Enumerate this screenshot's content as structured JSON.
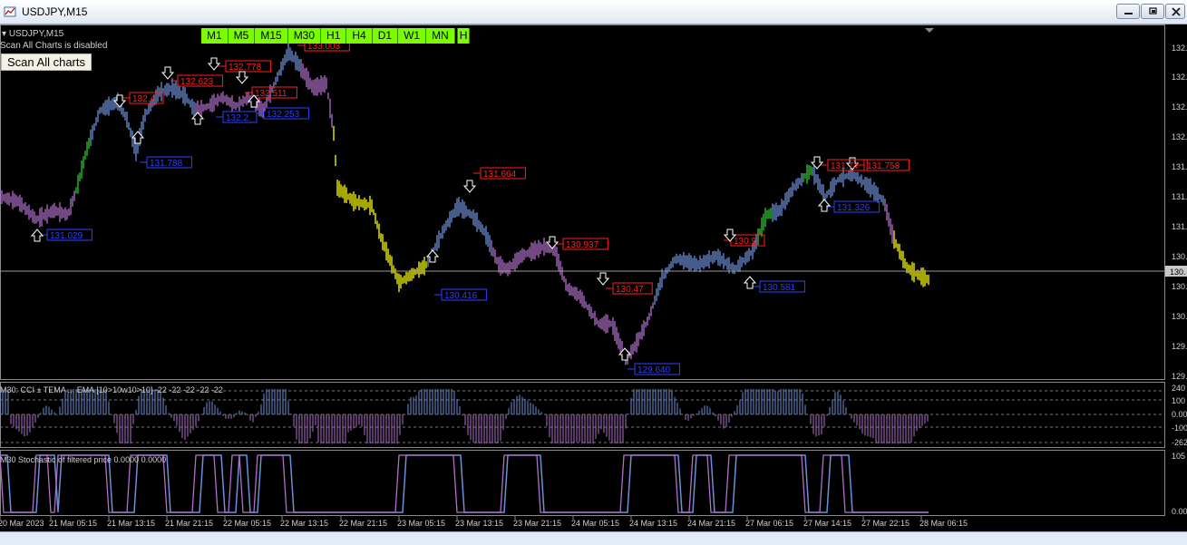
{
  "window": {
    "title": "USDJPY,M15",
    "controls": [
      "minimize",
      "restore",
      "close"
    ]
  },
  "chart": {
    "symbol_label": "USDJPY,M15",
    "status_text": "Scan All Charts is disabled",
    "scan_button": "Scan All charts",
    "timeframes": [
      "M1",
      "M5",
      "M15",
      "M30",
      "H1",
      "H4",
      "D1",
      "W1",
      "MN"
    ],
    "extra_button": "H",
    "price_axis": [
      "132.",
      "132.",
      "132.",
      "132.",
      "131.",
      "131.",
      "131.",
      "130.",
      "130.",
      "130.",
      "129.",
      "129."
    ],
    "current_price_tag": "130.",
    "sr_labels": [
      {
        "text": "133.003",
        "color": "red"
      },
      {
        "text": "132.778",
        "color": "red"
      },
      {
        "text": "132.623",
        "color": "red"
      },
      {
        "text": "132.511",
        "color": "red"
      },
      {
        "text": "132.4",
        "color": "red"
      },
      {
        "text": "132.253",
        "color": "blue"
      },
      {
        "text": "132.2",
        "color": "blue"
      },
      {
        "text": "131.788",
        "color": "blue"
      },
      {
        "text": "131.029",
        "color": "blue"
      },
      {
        "text": "131.664",
        "color": "red"
      },
      {
        "text": "130.937",
        "color": "red"
      },
      {
        "text": "130.416",
        "color": "blue"
      },
      {
        "text": "130.47",
        "color": "red"
      },
      {
        "text": "129.640",
        "color": "blue"
      },
      {
        "text": "131.758",
        "color": "red"
      },
      {
        "text": "131.74",
        "color": "red"
      },
      {
        "text": "131.326",
        "color": "blue"
      },
      {
        "text": "130.9",
        "color": "red"
      },
      {
        "text": "130.581",
        "color": "blue"
      }
    ],
    "cci_label": "M30: CCI ± TEMA ... EMA [10>10w10>10] -22 -22 -22 -22 -22",
    "cci_axis": [
      "240",
      "100",
      "0.00",
      "-100",
      "-262"
    ],
    "stoch_label": "M30 Stochastic of filtered price 0.0000 0.0000",
    "stoch_axis": [
      "105",
      "0.00"
    ],
    "time_axis": [
      "20 Mar 2023",
      "21 Mar 05:15",
      "21 Mar 13:15",
      "21 Mar 21:15",
      "22 Mar 05:15",
      "22 Mar 13:15",
      "22 Mar 21:15",
      "23 Mar 05:15",
      "23 Mar 13:15",
      "23 Mar 21:15",
      "24 Mar 05:15",
      "24 Mar 13:15",
      "24 Mar 21:15",
      "27 Mar 06:15",
      "27 Mar 14:15",
      "27 Mar 22:15",
      "28 Mar 06:15"
    ]
  },
  "colors": {
    "up": "#6b8fd8",
    "down": "#b070c8",
    "bull": "#2ec82e",
    "bear": "#ffff00",
    "resistance": "#ff2020",
    "support": "#2f3fff",
    "tf_bg": "#7cfc00"
  }
}
